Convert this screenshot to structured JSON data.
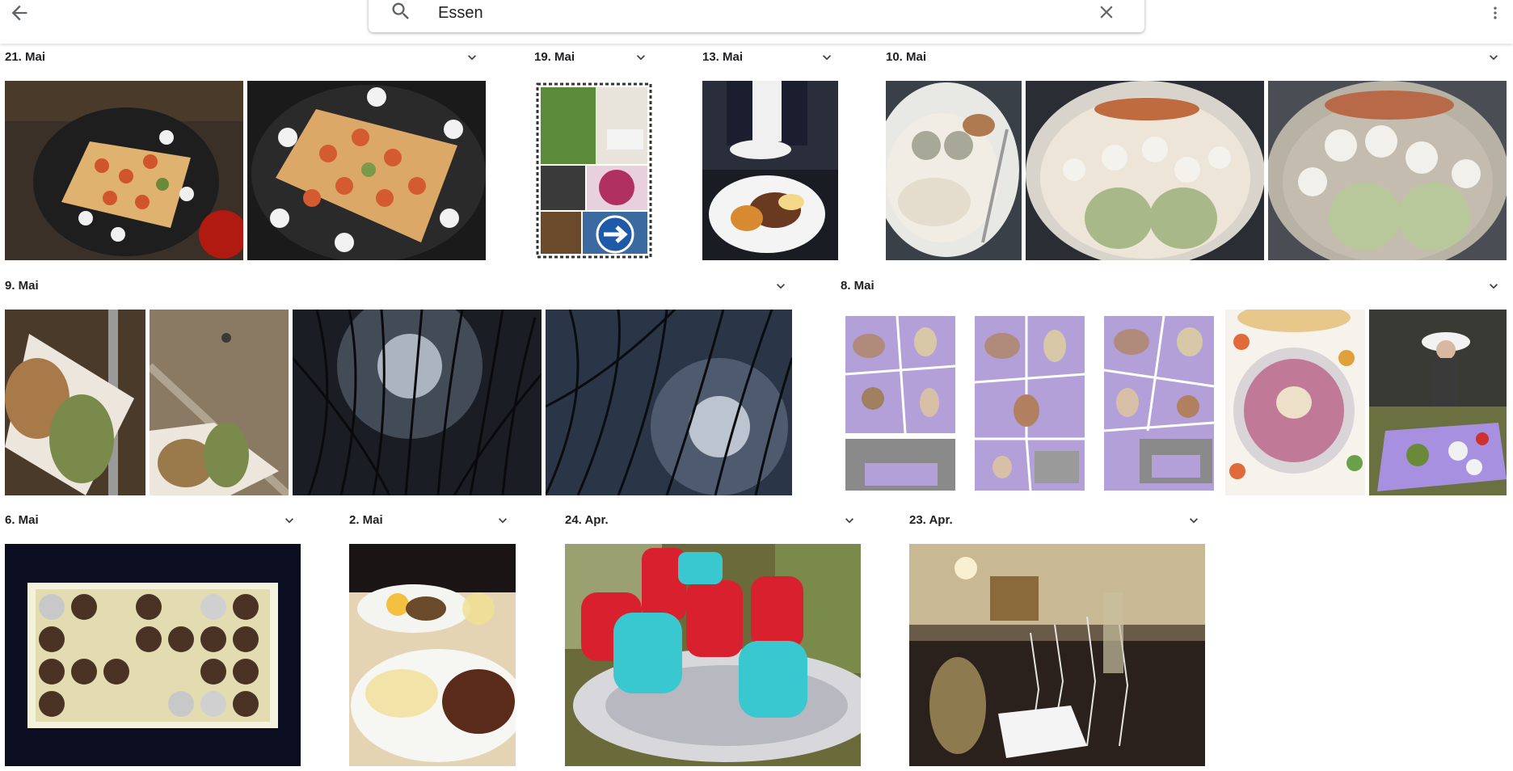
{
  "search": {
    "query": "Essen"
  },
  "groups": [
    {
      "date": "21. Mai"
    },
    {
      "date": "19. Mai"
    },
    {
      "date": "13. Mai"
    },
    {
      "date": "10. Mai"
    },
    {
      "date": "9. Mai"
    },
    {
      "date": "8. Mai"
    },
    {
      "date": "6. Mai"
    },
    {
      "date": "2. Mai"
    },
    {
      "date": "24. Apr."
    },
    {
      "date": "23. Apr."
    }
  ]
}
